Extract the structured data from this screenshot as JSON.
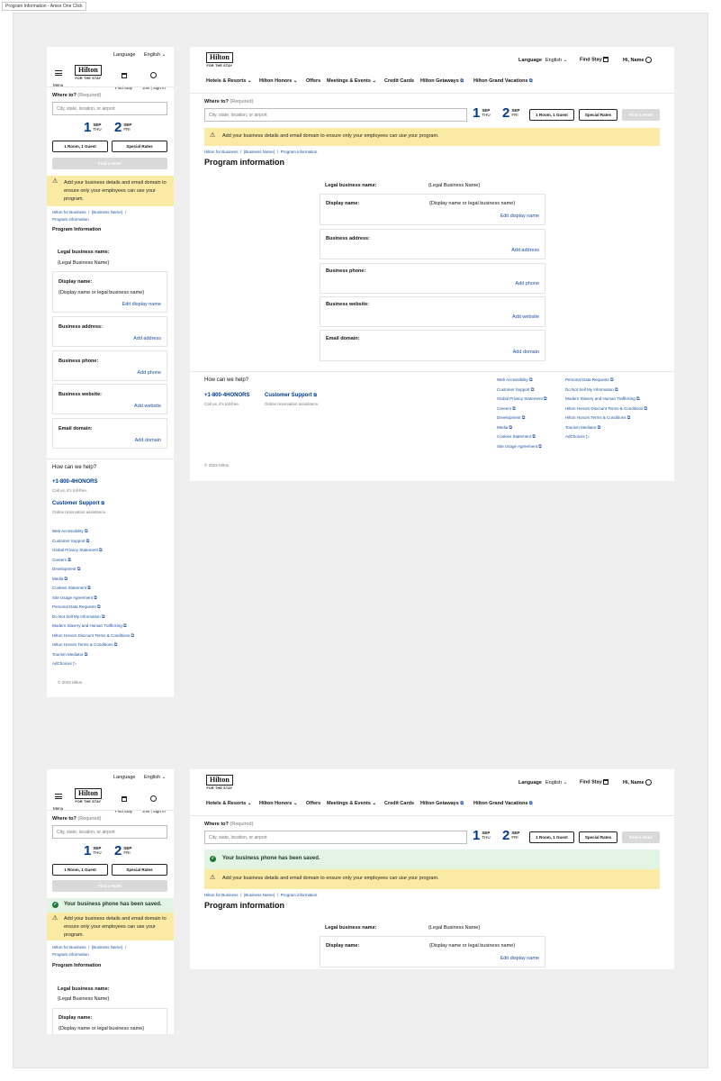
{
  "frame_title": "Program Information - Amex One Click",
  "brand": {
    "logo_text": "Hilton",
    "tagline": "FOR THE STAY"
  },
  "header": {
    "language_label": "Language",
    "language_value": "English",
    "find_stay": "Find Stay",
    "join_sign_in": "Join | Sign In",
    "menu": "Menu",
    "greeting": "Hi, Name"
  },
  "nav": [
    "Hotels & Resorts",
    "Hilton Honors",
    "Offers",
    "Meetings & Events",
    "Credit Cards",
    "Hilton Getaways",
    "Hilton Grand Vacations"
  ],
  "search": {
    "where_label": "Where to?",
    "required": "(Required)",
    "placeholder": "City, state, location, or airport",
    "checkin_day": "1",
    "checkin_month": "SEP",
    "checkin_dow": "THU",
    "checkout_day": "2",
    "checkout_month": "SEP",
    "checkout_dow": "FRI",
    "rooms_guests": "1 Room, 1 Guest",
    "special_rates": "Special Rates",
    "find_hotel": "Find a Hotel"
  },
  "alerts": {
    "warning": "Add your business details and email domain to ensure only your employees can use your program.",
    "success": "Your business phone has been saved."
  },
  "breadcrumb": [
    "Hilton for Business",
    "{Business Name}",
    "Program information"
  ],
  "page": {
    "title_desktop": "Program information",
    "title_mobile": "Program Information"
  },
  "fields": {
    "legal_label": "Legal business name:",
    "legal_value": "{Legal Business Name}",
    "display_label": "Display name:",
    "display_value": "{Display name or legal business name}",
    "display_action": "Edit display name",
    "address_label": "Business address:",
    "address_action": "Add address",
    "phone_label": "Business phone:",
    "phone_action": "Add phone",
    "website_label": "Business website:",
    "website_action": "Add website",
    "email_label": "Email domain:",
    "email_action": "Add domain"
  },
  "footer": {
    "help_title": "How can we help?",
    "phone": "+1-800-4HONORS",
    "phone_sub": "Call us, it's toll-free.",
    "support": "Customer Support",
    "support_sub": "Online reservation assistance.",
    "links_col1": [
      "Web Accessibility",
      "Customer Support",
      "Global Privacy Statement",
      "Careers",
      "Development",
      "Media",
      "Cookies Statement",
      "Site Usage Agreement"
    ],
    "links_col2": [
      "Personal Data Requests",
      "Do Not Sell My Information",
      "Modern Slavery and Human Trafficking",
      "Hilton Honors Discount Terms & Conditions",
      "Hilton Honors Terms & Conditions",
      "Tourism Mediator",
      "AdChoices"
    ],
    "copyright": "© 2023 Hilton"
  },
  "colors": {
    "brand_blue": "#003a8c",
    "link_blue": "#1a52a3",
    "warning_bg": "#fbeaa4",
    "success_bg": "#e3f3e4",
    "success_icon": "#1e7b34"
  }
}
